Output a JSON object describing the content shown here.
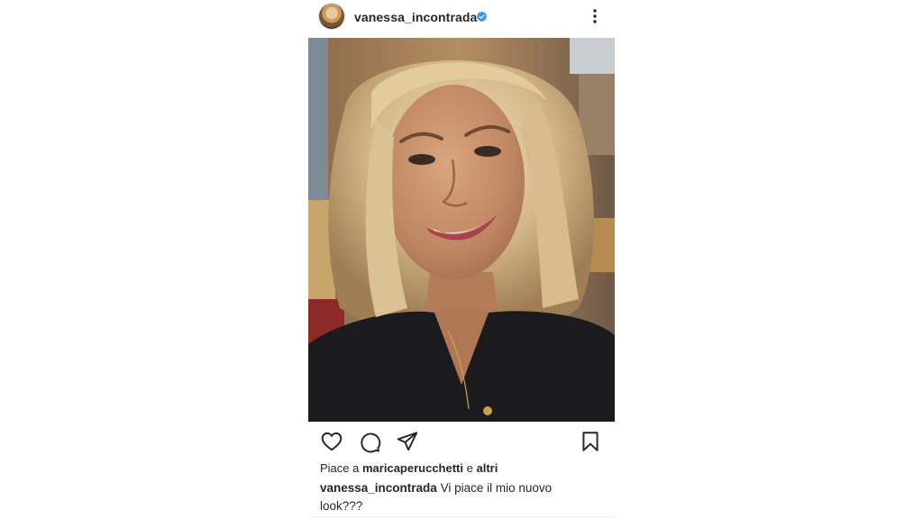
{
  "post": {
    "username": "vanessa_incontrada",
    "photo_alt": "vanessa_incontrada",
    "likes": {
      "prefix": "Piace a",
      "user": "maricaperucchetti",
      "connector": "e",
      "others": "altri"
    },
    "caption": {
      "username": "vanessa_incontrada",
      "text": "Vi piace il mio nuovo look???"
    }
  },
  "icons": {
    "verified": "verified-badge-icon",
    "more": "more-options-icon",
    "like": "heart-icon",
    "comment": "comment-icon",
    "share": "send-icon",
    "save": "bookmark-icon"
  },
  "colors": {
    "verified": "#3897f0",
    "text": "#262626"
  }
}
